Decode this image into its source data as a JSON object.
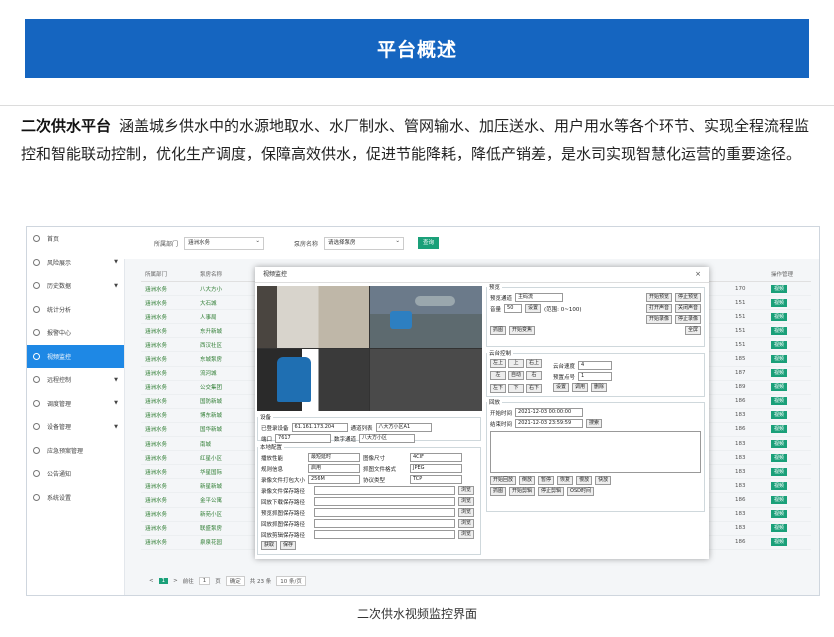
{
  "banner": {
    "title": "平台概述"
  },
  "intro": {
    "term": "二次供水平台",
    "text": "涵盖城乡供水中的水源地取水、水厂制水、管网输水、加压送水、用户用水等各个环节、实现全程流程监控和智能联动控制，优化生产调度，保障高效供水，促进节能降耗，降低产销差，是水司实现智慧化运营的重要途径。"
  },
  "sidebar": {
    "items": [
      {
        "label": "首页"
      },
      {
        "label": "风险展示"
      },
      {
        "label": "历史数据"
      },
      {
        "label": "统计分析"
      },
      {
        "label": "报警中心"
      },
      {
        "label": "视频监控"
      },
      {
        "label": "远程控制"
      },
      {
        "label": "调度管理"
      },
      {
        "label": "设备管理"
      },
      {
        "label": "应急预案管理"
      },
      {
        "label": "公告通知"
      },
      {
        "label": "系统设置"
      }
    ]
  },
  "filter": {
    "label1": "所属部门",
    "value1": "涵洲水务",
    "label2": "泵房名称",
    "value2": "请选择泵房",
    "query": "查询"
  },
  "table": {
    "headers": [
      "所属部门",
      "泵房名称",
      "",
      "操作管理"
    ],
    "rows": [
      [
        "涵洲水务",
        "八大方小",
        "170",
        "视频"
      ],
      [
        "涵洲水务",
        "大石城",
        "151",
        "视频"
      ],
      [
        "涵洲水务",
        "人事局",
        "151",
        "视频"
      ],
      [
        "涵洲水务",
        "东升新城",
        "151",
        "视频"
      ],
      [
        "涵洲水务",
        "西汉社区",
        "151",
        "视频"
      ],
      [
        "涵洲水务",
        "东城泵房",
        "185",
        "视频"
      ],
      [
        "涵洲水务",
        "流河城",
        "187",
        "视频"
      ],
      [
        "涵洲水务",
        "公交集团",
        "189",
        "视频"
      ],
      [
        "涵洲水务",
        "国防新城",
        "186",
        "视频"
      ],
      [
        "涵洲水务",
        "博东新城",
        "183",
        "视频"
      ],
      [
        "涵洲水务",
        "国华新城",
        "186",
        "视频"
      ],
      [
        "涵洲水务",
        "南城",
        "183",
        "视频"
      ],
      [
        "涵洲水务",
        "红星小区",
        "183",
        "视频"
      ],
      [
        "涵洲水务",
        "华星国际",
        "183",
        "视频"
      ],
      [
        "涵洲水务",
        "新星新城",
        "183",
        "视频"
      ],
      [
        "涵洲水务",
        "金平公寓",
        "186",
        "视频"
      ],
      [
        "涵洲水务",
        "新苑小区",
        "183",
        "视频"
      ],
      [
        "涵洲水务",
        "联盛泵房",
        "183",
        "视频"
      ],
      [
        "涵洲水务",
        "泉泉花园",
        "186",
        "视频"
      ]
    ]
  },
  "pager": {
    "prev": "<",
    "page": "1",
    "next": ">",
    "goto": "前往",
    "page_input": "1",
    "page_unit": "页",
    "confirm": "确定",
    "total": "共 23 条",
    "per_page": "10 条/页"
  },
  "dialog": {
    "title": "视频监控",
    "close": "×",
    "preview": {
      "legend": "预览",
      "channel_label": "预览通道",
      "channel_value": "主码流",
      "btn_start": "开始预览",
      "btn_stop": "停止预览",
      "btn_open_sound": "打开声音",
      "btn_close_sound": "关闭声音",
      "btn_record": "开始录像",
      "btn_stop_record": "停止录像",
      "volume_label": "音量",
      "volume_value": "50",
      "btn_set": "设置",
      "range": "(范围: 0~100)",
      "btn_capture": "抓图",
      "btn_capture_jpeg": "开始变焦",
      "btn_fullscreen": "全屏"
    },
    "ptz": {
      "legend": "云台控制",
      "dirs": [
        "左上",
        "上",
        "右上",
        "左",
        "自动",
        "右",
        "左下",
        "下",
        "右下"
      ],
      "speed_label": "云台速度",
      "speed_value": "4",
      "preset_label": "预置点号",
      "preset_value": "1",
      "btn_set": "设置",
      "btn_call": "调用",
      "btn_del": "删除"
    },
    "playback": {
      "legend": "回放",
      "start_label": "开始时间",
      "start_value": "2021-12-03 00:00:00",
      "end_label": "结束时间",
      "end_value": "2021-12-03 23:59:59",
      "btn_search": "搜索",
      "btn_play": "开始回放",
      "btn_reverse": "倒放",
      "btn_pause": "暂停",
      "btn_resume": "恢复",
      "btn_slow": "慢放",
      "btn_fast": "快放",
      "btn_capture": "抓图",
      "btn_clip": "开始剪辑",
      "btn_stop_clip": "停止剪辑",
      "btn_osd": "OSD时间"
    },
    "device": {
      "legend": "设备",
      "ip_label": "已登录设备",
      "ip_value": "61.161.173.204",
      "channel_label": "通道列表",
      "channel_value": "八大方小区A1",
      "port_label": "端口",
      "port_value": "7617",
      "ch2_label": "数字通道",
      "ch2_value": "八大方小区"
    },
    "local": {
      "legend": "本地配置",
      "rows": [
        {
          "label": "播放性能",
          "value": "最短延时"
        },
        {
          "label": "图像尺寸",
          "value": "4CIF"
        },
        {
          "label": "规则信息",
          "value": "启用"
        },
        {
          "label": "抓图文件格式",
          "value": "JPEG"
        },
        {
          "label": "录像文件打包大小",
          "value": "256M"
        },
        {
          "label": "协议类型",
          "value": "TCP"
        }
      ],
      "paths": [
        "录像文件保存路径",
        "回放下载保存路径",
        "预览抓图保存路径",
        "回放抓图保存路径",
        "回放剪辑保存路径"
      ],
      "browse": "浏览",
      "btn_get": "获取",
      "btn_save": "保存"
    }
  }
}
